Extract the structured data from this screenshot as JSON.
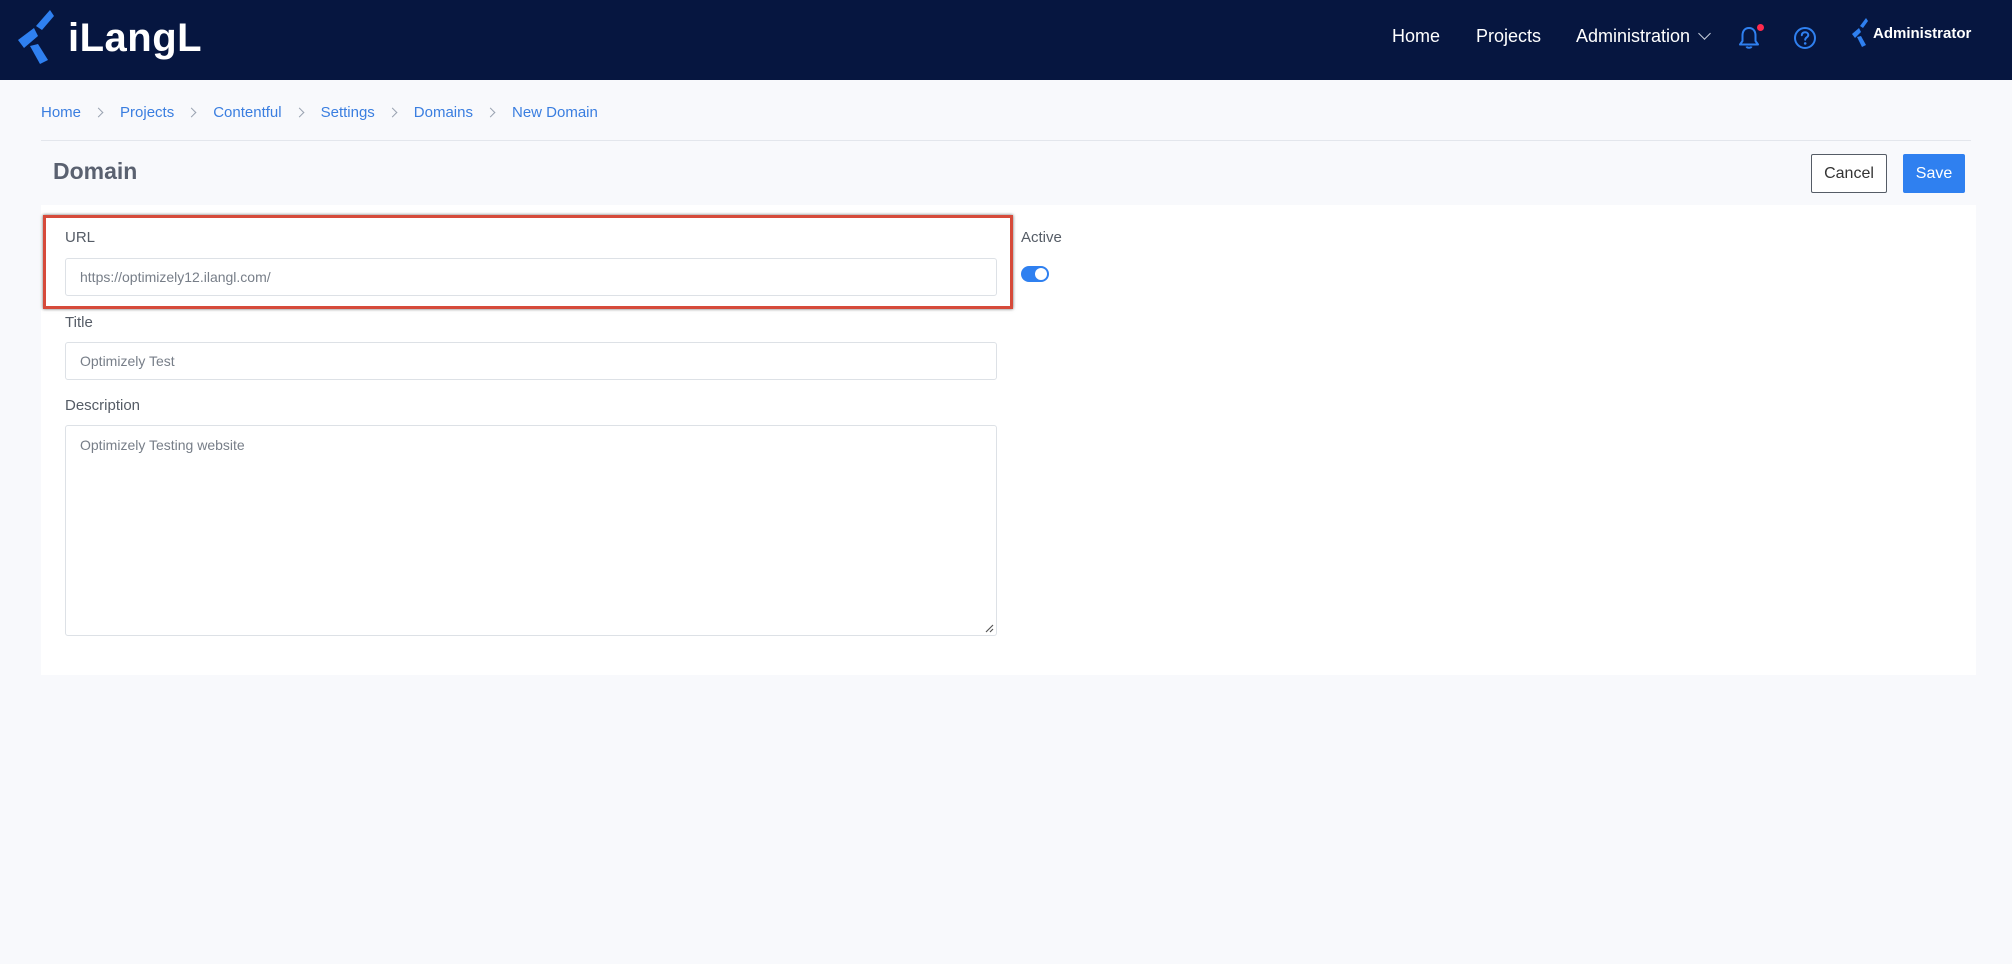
{
  "app": {
    "logo_text": "iLangL",
    "brand_color": "#061640",
    "accent_color": "#2f80f0"
  },
  "nav": {
    "home": "Home",
    "projects": "Projects",
    "administration": "Administration",
    "notification_icon": "bell-icon",
    "help_icon": "question-circle-icon",
    "user_icon": "ilangl-user-icon",
    "user_name": "Administrator"
  },
  "breadcrumb": {
    "items": [
      "Home",
      "Projects",
      "Contentful",
      "Settings",
      "Domains",
      "New Domain"
    ]
  },
  "page": {
    "title": "Domain",
    "cancel_label": "Cancel",
    "save_label": "Save"
  },
  "form": {
    "url": {
      "label": "URL",
      "value": "https://optimizely12.ilangl.com/"
    },
    "title": {
      "label": "Title",
      "placeholder": "Optimizely Test"
    },
    "description": {
      "label": "Description",
      "placeholder": "Optimizely Testing website"
    },
    "active": {
      "label": "Active",
      "value": true
    }
  }
}
